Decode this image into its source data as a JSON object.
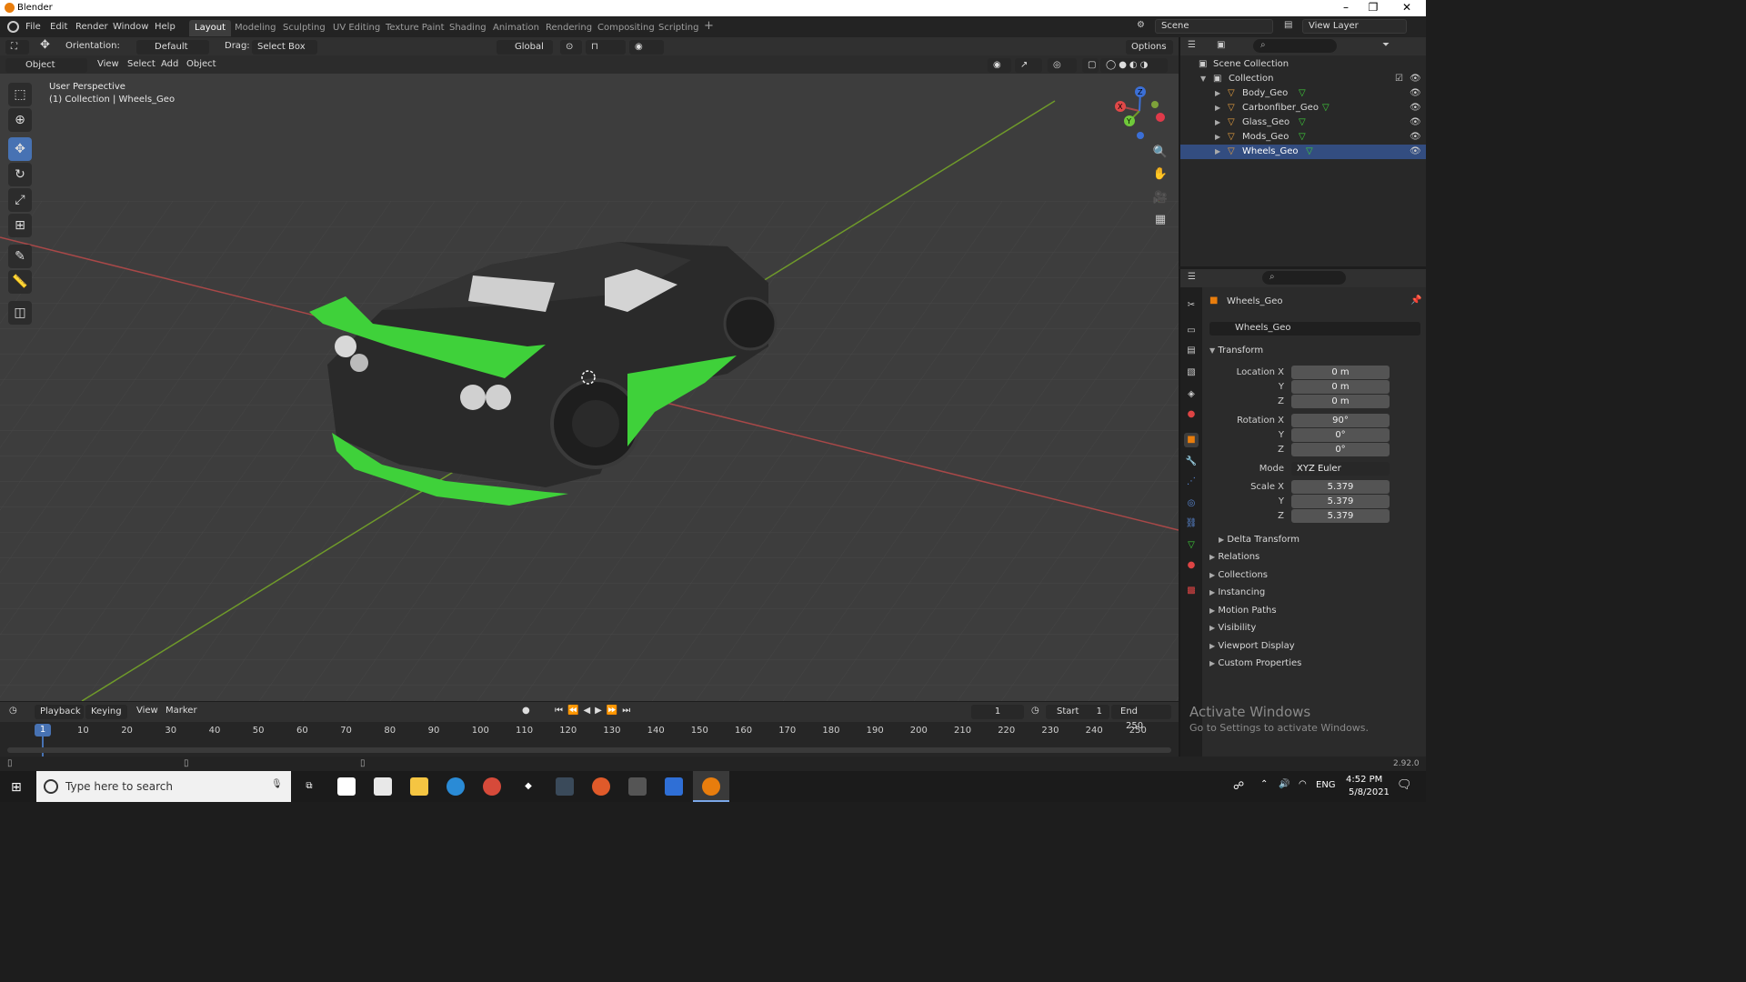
{
  "window": {
    "title": "Blender"
  },
  "menu": {
    "items": [
      "File",
      "Edit",
      "Render",
      "Window",
      "Help"
    ]
  },
  "workspaces": [
    "Layout",
    "Modeling",
    "Sculpting",
    "UV Editing",
    "Texture Paint",
    "Shading",
    "Animation",
    "Rendering",
    "Compositing",
    "Scripting"
  ],
  "top_right": {
    "scene": "Scene",
    "view_layer": "View Layer"
  },
  "toolheader": {
    "orientation_label": "Orientation:",
    "orientation_value": "Default",
    "drag_label": "Drag:",
    "drag_value": "Select Box",
    "transform": "Global",
    "options": "Options"
  },
  "viewheader": {
    "mode": "Object Mode",
    "view": "View",
    "select": "Select",
    "add": "Add",
    "object": "Object"
  },
  "viewport": {
    "perspective": "User Perspective",
    "collection_info": "(1) Collection | Wheels_Geo",
    "gizmo_x": "X",
    "gizmo_y": "Y",
    "gizmo_z": "Z"
  },
  "outliner": {
    "root": "Scene Collection",
    "collection": "Collection",
    "objects": [
      "Body_Geo",
      "Carbonfiber_Geo",
      "Glass_Geo",
      "Mods_Geo",
      "Wheels_Geo"
    ]
  },
  "properties": {
    "object_name": "Wheels_Geo",
    "datablock": "Wheels_Geo",
    "transform_label": "Transform",
    "location": {
      "label_x": "Location X",
      "label_y": "Y",
      "label_z": "Z",
      "x": "0 m",
      "y": "0 m",
      "z": "0 m"
    },
    "rotation": {
      "label_x": "Rotation X",
      "label_y": "Y",
      "label_z": "Z",
      "x": "90°",
      "y": "0°",
      "z": "0°"
    },
    "mode_label": "Mode",
    "mode_value": "XYZ Euler",
    "scale": {
      "label_x": "Scale X",
      "label_y": "Y",
      "label_z": "Z",
      "x": "5.379",
      "y": "5.379",
      "z": "5.379"
    },
    "delta": "Delta Transform",
    "panels": [
      "Relations",
      "Collections",
      "Instancing",
      "Motion Paths",
      "Visibility",
      "Viewport Display",
      "Custom Properties"
    ]
  },
  "timeline": {
    "playback": "Playback",
    "keying": "Keying",
    "view": "View",
    "marker": "Marker",
    "current": "1",
    "start_label": "Start",
    "start": "1",
    "end_label": "End",
    "end": "250",
    "frames": [
      "10",
      "20",
      "30",
      "40",
      "50",
      "60",
      "70",
      "80",
      "90",
      "100",
      "110",
      "120",
      "130",
      "140",
      "150",
      "160",
      "170",
      "180",
      "190",
      "200",
      "210",
      "220",
      "230",
      "240",
      "250"
    ],
    "cursor": "1"
  },
  "status": {
    "version": "2.92.0",
    "activate_title": "Activate Windows",
    "activate_sub": "Go to Settings to activate Windows."
  },
  "taskbar": {
    "search_placeholder": "Type here to search",
    "lang": "ENG",
    "time": "4:52 PM",
    "date": "5/8/2021"
  },
  "colors": {
    "accent": "#4772b3",
    "green": "#3fd13a",
    "orange": "#e87d0d"
  }
}
